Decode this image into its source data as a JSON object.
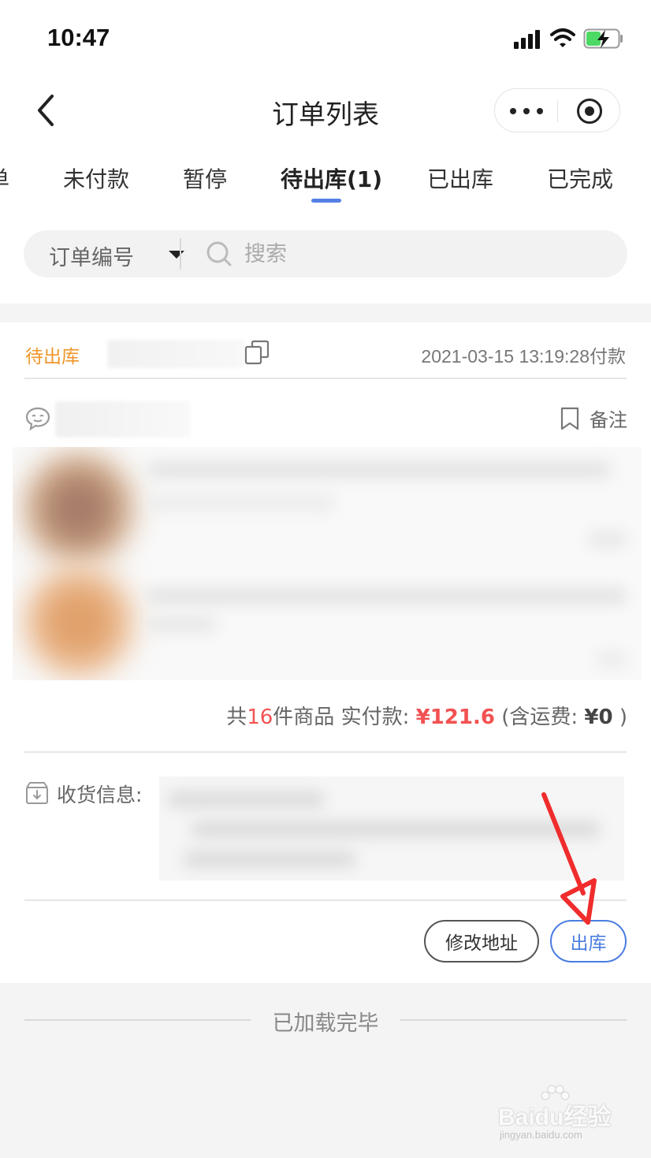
{
  "status_bar": {
    "time": "10:47"
  },
  "nav": {
    "title": "订单列表"
  },
  "tabs": [
    {
      "label": "单"
    },
    {
      "label": "未付款"
    },
    {
      "label": "暂停"
    },
    {
      "label": "待出库(1)"
    },
    {
      "label": "已出库"
    },
    {
      "label": "已完成"
    }
  ],
  "active_tab": "待出库(1)",
  "search": {
    "type_label": "订单编号",
    "placeholder": "搜索"
  },
  "order": {
    "status": "待出库",
    "pay_time": "2021-03-15 13:19:28付款",
    "remark_label": "备注",
    "summary": {
      "prefix": "共",
      "count": "16",
      "suffix": "件商品",
      "paid_label": "实付款:",
      "amount": "¥121.6",
      "shipping_prefix": "(含运费:",
      "shipping": "¥0",
      "shipping_suffix": ")"
    },
    "address_label": "收货信息:",
    "buttons": {
      "edit_address": "修改地址",
      "ship": "出库"
    }
  },
  "footer": {
    "loaded_text": "已加载完毕"
  },
  "watermark": {
    "main": "Baidu经验",
    "sub": "jingyan.baidu.com"
  },
  "colors": {
    "accent": "#5480e4",
    "status_orange": "#f0962a",
    "price_red": "#f25252",
    "annotation_arrow": "#f02c2c"
  }
}
